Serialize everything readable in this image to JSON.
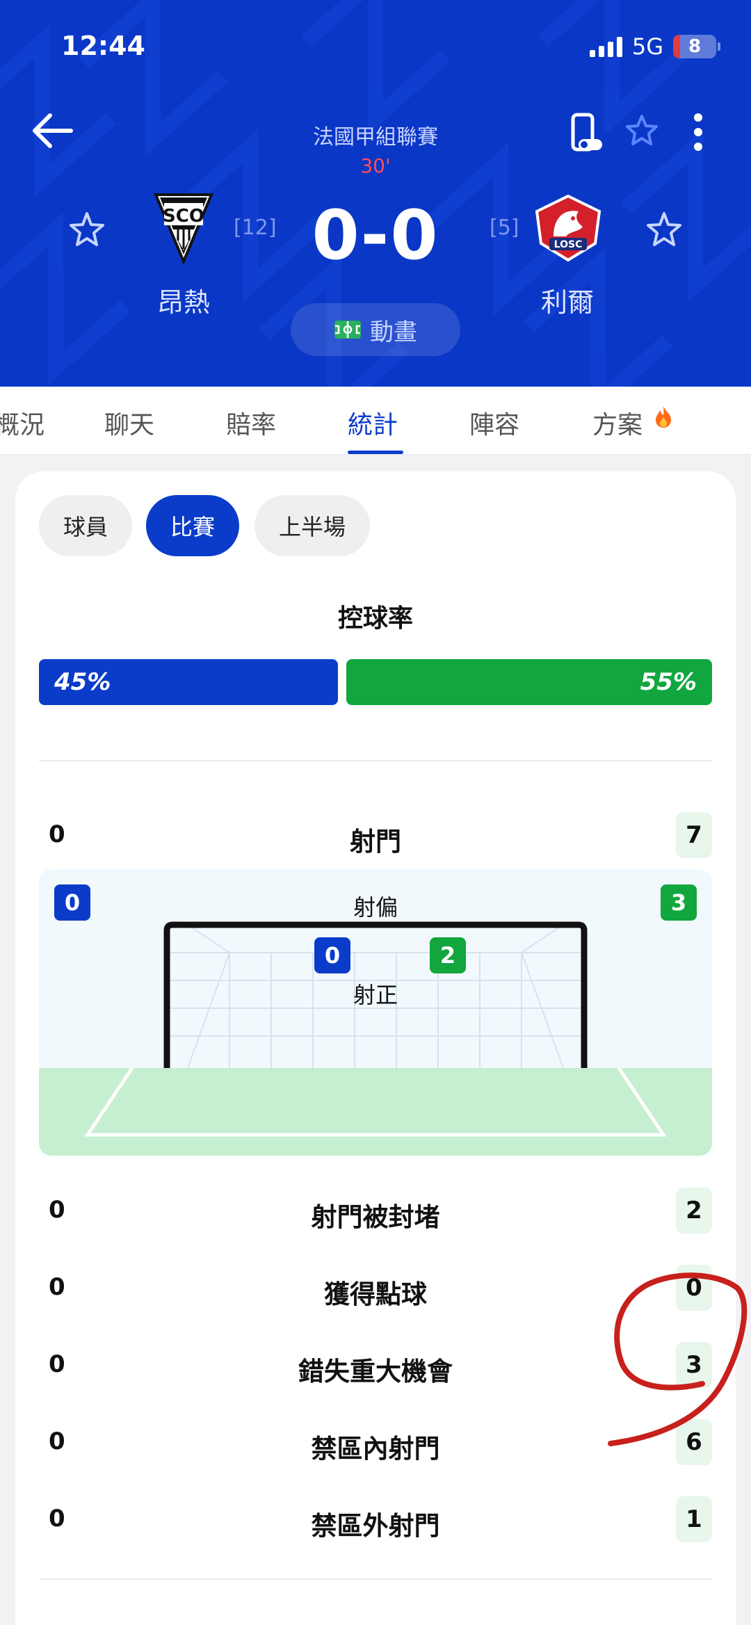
{
  "status_bar": {
    "time": "12:44",
    "network": "5G",
    "battery": "8"
  },
  "match": {
    "league": "法國甲組聯賽",
    "minute": "30'",
    "score": "0-0",
    "home": {
      "name": "昂熱",
      "rank": "[12]",
      "logo_text": "SCO"
    },
    "away": {
      "name": "利爾",
      "rank": "[5]",
      "logo_text": "LOSC"
    },
    "animation_label": "動畫"
  },
  "tabs": [
    {
      "label": "概況"
    },
    {
      "label": "聊天"
    },
    {
      "label": "賠率"
    },
    {
      "label": "統計"
    },
    {
      "label": "陣容"
    },
    {
      "label": "方案"
    }
  ],
  "active_tab": "統計",
  "filters": [
    {
      "label": "球員"
    },
    {
      "label": "比賽"
    },
    {
      "label": "上半場"
    }
  ],
  "active_filter": "比賽",
  "possession": {
    "title": "控球率",
    "home_label": "45%",
    "away_label": "55%",
    "home": 45,
    "away": 55
  },
  "shots": {
    "label": "射門",
    "home": "0",
    "away": "7"
  },
  "shot_map": {
    "off_target_label": "射偏",
    "off_target_home": "0",
    "off_target_away": "3",
    "on_target_label": "射正",
    "on_target_home": "0",
    "on_target_away": "2"
  },
  "stats": [
    {
      "label": "射門被封堵",
      "home": "0",
      "away": "2"
    },
    {
      "label": "獲得點球",
      "home": "0",
      "away": "0"
    },
    {
      "label": "錯失重大機會",
      "home": "0",
      "away": "3"
    },
    {
      "label": "禁區內射門",
      "home": "0",
      "away": "6"
    },
    {
      "label": "禁區外射門",
      "home": "0",
      "away": "1"
    }
  ],
  "colors": {
    "home": "#0b3cc9",
    "away": "#11a63e",
    "header": "#0a37c6",
    "annotation": "#c8201c"
  }
}
